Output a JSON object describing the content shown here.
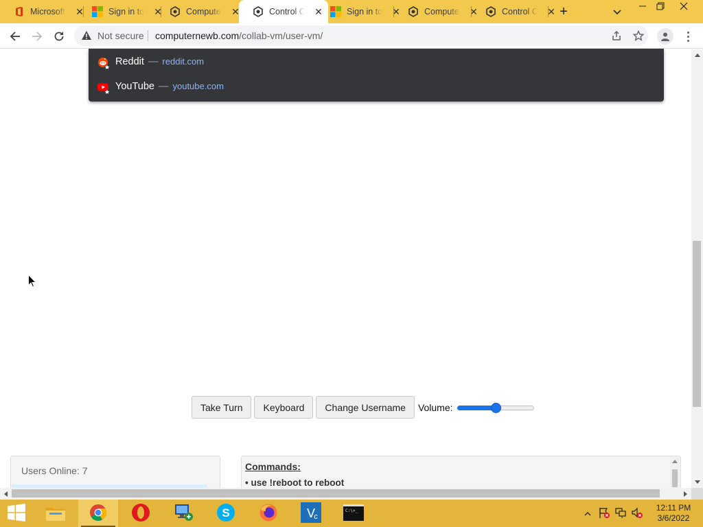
{
  "browser": {
    "tabs": [
      {
        "title": "Microsoft",
        "icon": "office-icon",
        "active": false
      },
      {
        "title": "Sign in to",
        "icon": "microsoft-logo-icon",
        "active": false
      },
      {
        "title": "Computernewb",
        "icon": "collabvm-icon",
        "active": false
      },
      {
        "title": "Control Center",
        "icon": "collabvm-icon",
        "active": true
      },
      {
        "title": "Sign in to",
        "icon": "microsoft-logo-icon",
        "active": false
      },
      {
        "title": "Computernewb",
        "icon": "collabvm-icon",
        "active": false
      },
      {
        "title": "Control Center",
        "icon": "collabvm-icon",
        "active": false
      }
    ],
    "new_tab_symbol": "+",
    "security_label": "Not secure",
    "url_domain": "computernewb.com",
    "url_path": "/collab-vm/user-vm/"
  },
  "suggestions": [
    {
      "name": "Reddit",
      "dash": "—",
      "url": "reddit.com",
      "color": "#ff4500"
    },
    {
      "name": "YouTube",
      "dash": "—",
      "url": "youtube.com",
      "color": "#ff0000"
    }
  ],
  "controls": {
    "take_turn": "Take Turn",
    "keyboard": "Keyboard",
    "change_username": "Change Username",
    "volume_label": "Volume:",
    "volume_value": 0.5
  },
  "users_panel": {
    "text": "Users Online: 7"
  },
  "commands_panel": {
    "title": "Commands:",
    "items": [
      "• use !reboot to reboot"
    ]
  },
  "taskbar": {
    "apps": [
      "file-explorer-icon",
      "chrome-icon",
      "opera-icon",
      "network-icon",
      "skype-icon",
      "firefox-icon",
      "vscode-icon",
      "terminal-icon"
    ],
    "active_app": "chrome-icon",
    "time": "12:11 PM",
    "date": "3/6/2022"
  },
  "colors": {
    "tabstrip": "#f2c94c",
    "taskbar": "#e3b53a",
    "dropdown": "#35363a",
    "link": "#8ab4f8",
    "accent": "#1a73e8"
  }
}
